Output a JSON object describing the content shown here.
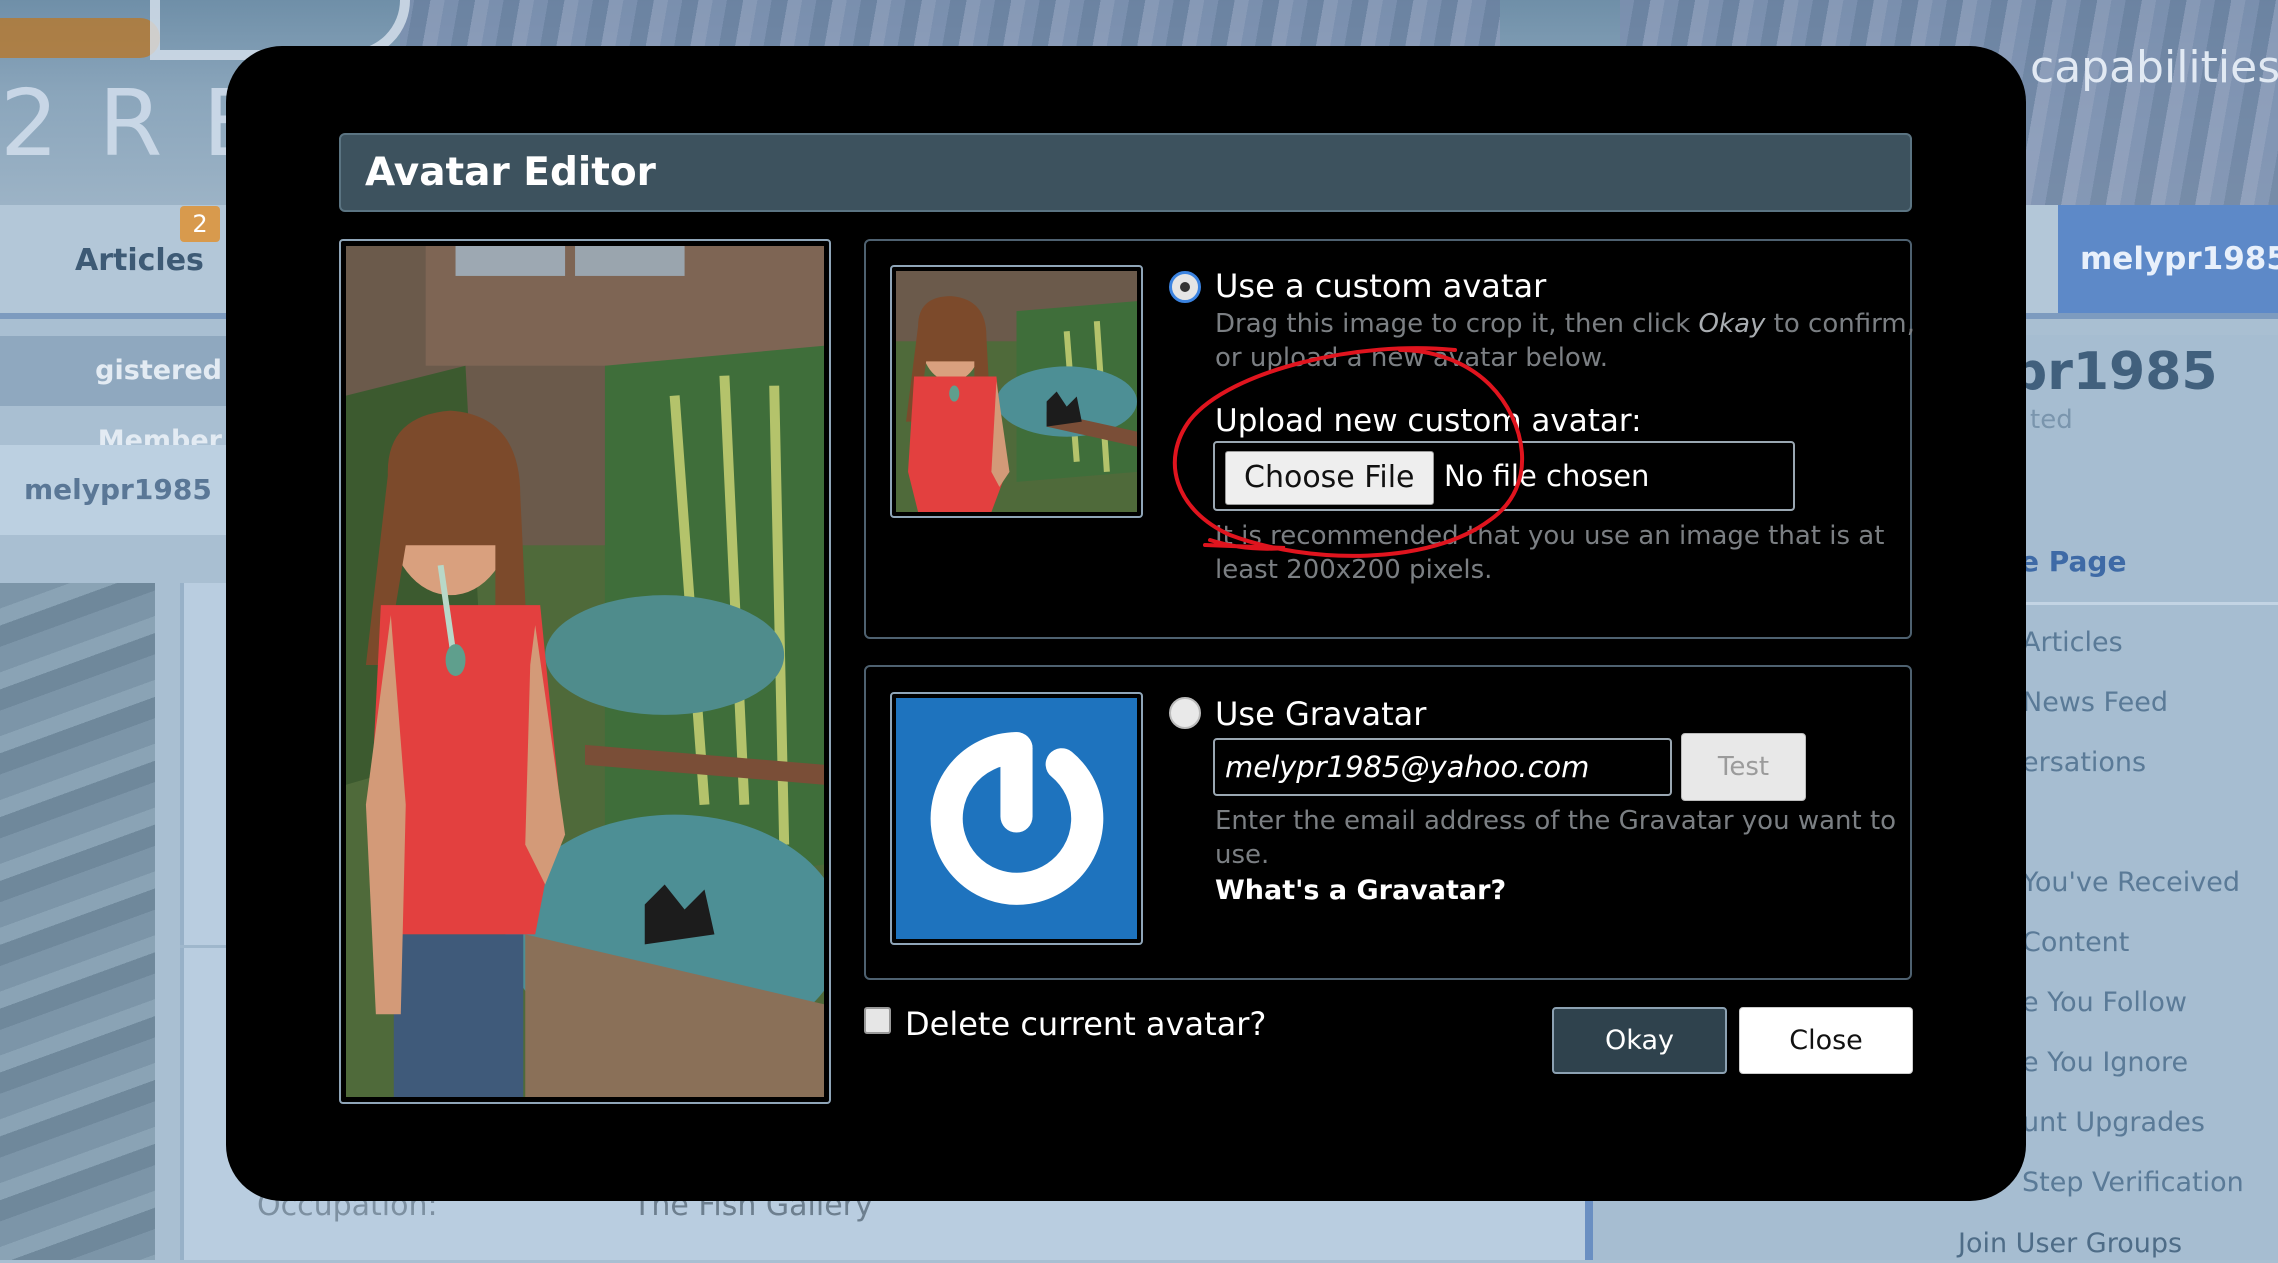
{
  "background": {
    "logo_text": "2RE",
    "tagline": "capabilities",
    "nav_articles": "Articles",
    "nav_badge": "2",
    "user_tab": "melypr1985",
    "subnav": "gistered Member",
    "breadcrumb": "melypr1985",
    "profile_name": "pr1985",
    "profile_sub": "ted",
    "profile_link": "e Page",
    "sidebar_items": [
      "Articles",
      "News Feed",
      "ersations",
      "You've Received",
      "Content",
      "e You Follow",
      "e You Ignore",
      "unt Upgrades",
      "Step Verification"
    ],
    "sidebar_join": "Join User Groups",
    "occupation_label": "Occupation:",
    "occupation_value": "The Fish Gallery"
  },
  "modal": {
    "title": "Avatar Editor",
    "custom": {
      "radio_label": "Use a custom avatar",
      "hint_line1_pre": "Drag this image to crop it, then click ",
      "hint_line1_em": "Okay",
      "hint_line1_post": " to confirm,",
      "hint_line2": "or upload a new avatar below.",
      "upload_label": "Upload new custom avatar:",
      "choose_file": "Choose File",
      "file_status": "No file chosen",
      "recommend_line1": "It is recommended that you use an image that is at",
      "recommend_line2": "least 200x200 pixels."
    },
    "gravatar": {
      "radio_label": "Use Gravatar",
      "email": "melypr1985@yahoo.com",
      "test_button": "Test",
      "hint_line1": "Enter the email address of the Gravatar you want to",
      "hint_line2": "use.",
      "whats_link": "What's a Gravatar?"
    },
    "delete_label": "Delete current avatar?",
    "okay_button": "Okay",
    "close_button": "Close"
  },
  "colors": {
    "modal_bg": "#000000",
    "title_bar": "#3d525e",
    "okay_bg": "#2f424d",
    "gravatar_blue": "#1e73be",
    "annotation_red": "#e0141e"
  }
}
